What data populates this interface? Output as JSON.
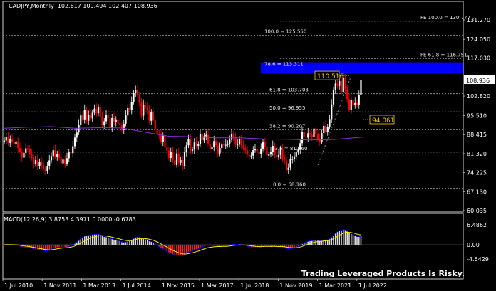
{
  "header": {
    "symbol": "CADJPY,Monthly",
    "ohlc": "102.617 109.494 102.407 108.936"
  },
  "macd_header": {
    "label": "MACD(12,26,9) 3.8753 4.3971 0.0000 -0.6783"
  },
  "disclaimer": "Trading Leveraged Products Is Risky.",
  "colors": {
    "background": "#000000",
    "grid": "#3a3a3a",
    "bull": "#ffffff",
    "bear": "#ff0000",
    "ma": "#8b2be2",
    "fib_band": "#0000ff",
    "callout": "#ffcc00",
    "macd_signal": "#ffee00",
    "macd_line": "#0000ff"
  },
  "chart_data": [
    {
      "type": "candlestick",
      "symbol": "CADJPY",
      "timeframe": "Monthly",
      "ylim": [
        60.035,
        131.27
      ],
      "y_ticks": [
        {
          "value": 131.27,
          "label": "131.270"
        },
        {
          "value": 124.05,
          "label": "124.050"
        },
        {
          "value": 117.03,
          "label": "117.030"
        },
        {
          "value": 108.936,
          "label": "108.936",
          "highlight": true
        },
        {
          "value": 102.82,
          "label": "102.820"
        },
        {
          "value": 95.51,
          "label": "95.510"
        },
        {
          "value": 88.415,
          "label": "88.415"
        },
        {
          "value": 81.32,
          "label": "81.320"
        },
        {
          "value": 74.225,
          "label": "74.225"
        },
        {
          "value": 67.13,
          "label": "67.130"
        },
        {
          "value": 60.035,
          "label": "60.035"
        }
      ],
      "x_ticks": [
        "1 Jul 2010",
        "1 Nov 2011",
        "1 Mar 2013",
        "1 Jul 2014",
        "1 Nov 2015",
        "1 Mar 2017",
        "1 Jul 2018",
        "1 Nov 2019",
        "1 Mar 2021",
        "1 Jul 2022"
      ],
      "closes": [
        86.2,
        87.4,
        85.3,
        86.9,
        85.6,
        84.9,
        85.9,
        83.4,
        82.1,
        79.8,
        81.6,
        83.3,
        82.9,
        81.2,
        79.7,
        77.4,
        78.9,
        76.7,
        78.3,
        77.1,
        75.4,
        74.9,
        76.8,
        78.8,
        80.4,
        82.6,
        80.2,
        81.2,
        79.8,
        77.7,
        79.1,
        77.6,
        79.6,
        81.8,
        81.5,
        84.1,
        87.3,
        89.2,
        92.2,
        95.6,
        94.1,
        97.7,
        93.6,
        95.8,
        94.5,
        96.6,
        98.1,
        96.4,
        98.6,
        95.1,
        91.9,
        93.4,
        95.9,
        94.5,
        91.0,
        94.6,
        93.0,
        94.1,
        92.7,
        91.9,
        90.1,
        92.5,
        95.6,
        98.3,
        97.6,
        100.7,
        103.9,
        105.1,
        103.3,
        100.4,
        95.5,
        99.6,
        98.9,
        97.6,
        93.6,
        96.8,
        94.0,
        90.5,
        88.6,
        88.1,
        85.7,
        88.0,
        83.6,
        82.5,
        79.7,
        81.9,
        78.9,
        77.1,
        81.4,
        77.9,
        78.9,
        76.6,
        81.8,
        84.4,
        86.7,
        82.4,
        82.8,
        85.5,
        84.2,
        84.8,
        88.5,
        86.3,
        87.8,
        88.3,
        85.1,
        83.1,
        83.8,
        86.0,
        84.4,
        81.4,
        83.4,
        84.7,
        84.4,
        84.6,
        85.1,
        86.5,
        88.5,
        87.5,
        84.6,
        84.7,
        86.7,
        84.4,
        83.5,
        82.6,
        80.9,
        80.4,
        80.6,
        82.6,
        82.9,
        82.2,
        81.2,
        83.2,
        85.6,
        84.0,
        80.6,
        81.0,
        82.1,
        84.2,
        80.7,
        79.9,
        80.8,
        83.1,
        79.1,
        78.8,
        75.2,
        76.1,
        79.2,
        79.3,
        80.3,
        81.8,
        82.8,
        85.2,
        89.5,
        87.7,
        87.3,
        88.9,
        88.3,
        87.6,
        90.7,
        88.5,
        86.8,
        85.8,
        89.0,
        91.7,
        89.5,
        91.3,
        94.2,
        99.7,
        105.1,
        107.5,
        106.6,
        108.4,
        104.3,
        109.8,
        105.4,
        101.7,
        97.8,
        101.4,
        99.6,
        100.2,
        99.6,
        103.3,
        108.9
      ]
    },
    {
      "type": "fibonacci",
      "levels": [
        {
          "label": "FE 100.0 = 130.777",
          "value": 130.777
        },
        {
          "label": "100.0 = 125.550",
          "value": 125.55
        },
        {
          "label": "FE 61.8 = 116.751",
          "value": 116.751
        },
        {
          "label": "78.6 = 113.311",
          "value": 113.311,
          "highlight": true
        },
        {
          "label": "61.8 = 103.703",
          "value": 103.703
        },
        {
          "label": "50.0 = 96.955",
          "value": 96.955
        },
        {
          "label": "38.2 = 90.207",
          "value": 90.207
        },
        {
          "label": "23.6 = 81.860",
          "value": 81.86
        },
        {
          "label": "0.0 = 68.360",
          "value": 68.36
        }
      ],
      "callouts": [
        {
          "label": "110.516",
          "value": 110.516
        },
        {
          "label": "94.061",
          "value": 94.061
        }
      ]
    },
    {
      "type": "line",
      "name": "moving average",
      "points": [
        [
          0,
          90.8
        ],
        [
          12,
          91.2
        ],
        [
          24,
          91.4
        ],
        [
          36,
          90.8
        ],
        [
          48,
          91.0
        ],
        [
          60,
          90.9
        ],
        [
          72,
          89.3
        ],
        [
          84,
          87.8
        ],
        [
          96,
          87.6
        ],
        [
          108,
          87.2
        ],
        [
          120,
          87.2
        ],
        [
          132,
          86.8
        ],
        [
          144,
          86.7
        ],
        [
          156,
          86.4
        ],
        [
          168,
          86.6
        ],
        [
          180,
          87.3
        ],
        [
          183,
          87.5
        ]
      ]
    },
    {
      "type": "macd",
      "title": "MACD(12,26,9)",
      "ylim": [
        -4.6429,
        6.4862
      ],
      "y_ticks": [
        {
          "value": 6.4862,
          "label": "6.4862"
        },
        {
          "value": 0.0,
          "label": "0.00"
        },
        {
          "value": -4.6429,
          "label": "-4.6429"
        }
      ]
    }
  ]
}
